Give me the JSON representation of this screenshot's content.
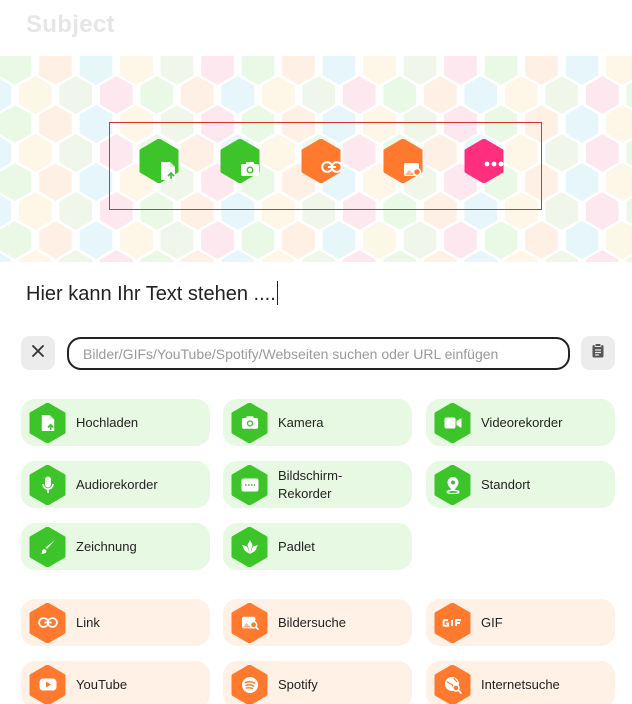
{
  "header": {
    "title": "Subject"
  },
  "quick_actions": [
    {
      "icon": "upload-file-icon",
      "color": "#3ec42b"
    },
    {
      "icon": "camera-icon",
      "color": "#3ec42b"
    },
    {
      "icon": "link-icon",
      "color": "#ff7a2f"
    },
    {
      "icon": "image-search-icon",
      "color": "#ff7a2f"
    },
    {
      "icon": "more-icon",
      "color": "#ff2f7e"
    }
  ],
  "body": {
    "text": "Hier kann Ihr Text stehen ...."
  },
  "search": {
    "placeholder": "Bilder/GIFs/YouTube/Spotify/Webseiten suchen oder URL einfügen"
  },
  "colors": {
    "green": "#3ec42b",
    "green_bg": "#e8f9e3",
    "orange": "#ff7a2f",
    "orange_bg": "#fff1e6",
    "pink": "#ff2f7e"
  },
  "attachments": {
    "green": [
      {
        "label": "Hochladen",
        "icon": "upload-file-icon"
      },
      {
        "label": "Kamera",
        "icon": "camera-icon"
      },
      {
        "label": "Videorekorder",
        "icon": "video-camera-icon"
      },
      {
        "label": "Audiorekorder",
        "icon": "microphone-icon"
      },
      {
        "label": "Bildschirm-\nRekorder",
        "icon": "screen-recorder-icon"
      },
      {
        "label": "Standort",
        "icon": "location-pin-icon"
      },
      {
        "label": "Zeichnung",
        "icon": "brush-icon"
      },
      {
        "label": "Padlet",
        "icon": "padlet-icon"
      }
    ],
    "orange": [
      {
        "label": "Link",
        "icon": "link-icon"
      },
      {
        "label": "Bildersuche",
        "icon": "image-search-icon"
      },
      {
        "label": "GIF",
        "icon": "gif-icon"
      },
      {
        "label": "YouTube",
        "icon": "youtube-icon"
      },
      {
        "label": "Spotify",
        "icon": "spotify-icon"
      },
      {
        "label": "Internetsuche",
        "icon": "globe-search-icon"
      }
    ]
  }
}
